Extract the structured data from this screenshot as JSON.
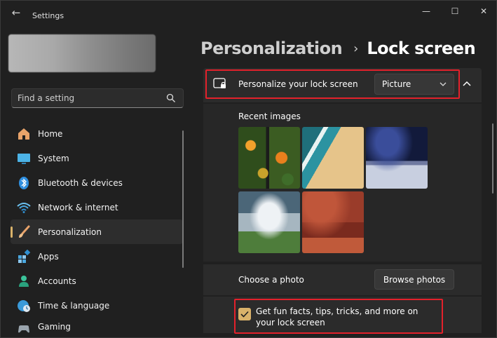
{
  "window": {
    "title": "Settings",
    "minimize": "—",
    "maximize": "☐",
    "close": "✕"
  },
  "search": {
    "placeholder": "Find a setting"
  },
  "sidebar": {
    "items": [
      {
        "label": "Home",
        "icon": "home-icon"
      },
      {
        "label": "System",
        "icon": "monitor-icon"
      },
      {
        "label": "Bluetooth & devices",
        "icon": "bluetooth-icon"
      },
      {
        "label": "Network & internet",
        "icon": "wifi-icon"
      },
      {
        "label": "Personalization",
        "icon": "brush-icon",
        "active": true
      },
      {
        "label": "Apps",
        "icon": "apps-icon"
      },
      {
        "label": "Accounts",
        "icon": "person-icon"
      },
      {
        "label": "Time & language",
        "icon": "globe-clock-icon"
      },
      {
        "label": "Gaming",
        "icon": "gamepad-icon"
      }
    ]
  },
  "breadcrumb": {
    "parent": "Personalization",
    "separator": "›",
    "current": "Lock screen"
  },
  "lock_screen": {
    "personalize_label": "Personalize your lock screen",
    "personalize_value": "Picture",
    "recent_images_label": "Recent images",
    "choose_photo_label": "Choose a photo",
    "browse_button": "Browse photos",
    "fun_facts_label": "Get fun facts, tips, tricks, and more on your lock screen",
    "fun_facts_checked": true
  },
  "colors": {
    "accent": "#d9b26a",
    "highlight": "#e3212b",
    "background": "#202020",
    "card": "#2b2b2b"
  }
}
